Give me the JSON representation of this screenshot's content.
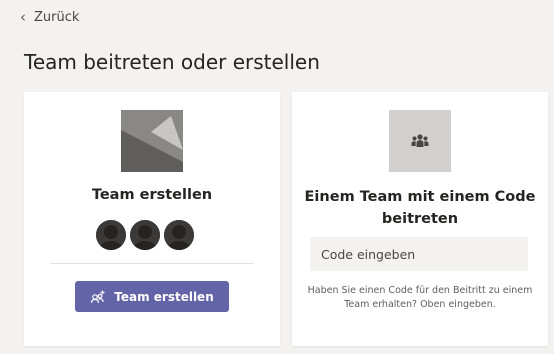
{
  "nav": {
    "back_label": "Zurück"
  },
  "page": {
    "title": "Team beitreten oder erstellen"
  },
  "create_card": {
    "title": "Team erstellen",
    "button_label": "Team erstellen",
    "button_icon": "add-team-icon",
    "image_icon": "team-image-placeholder",
    "avatar_count": 3
  },
  "join_card": {
    "title": "Einem Team mit einem Code beitreten",
    "image_icon": "people-group-icon",
    "code_placeholder": "Code eingeben",
    "help_text": "Haben Sie einen Code für den Beitritt zu einem Team erhalten? Oben eingeben."
  },
  "colors": {
    "accent": "#6264a7",
    "page_background": "#f3f2f1",
    "card_background": "#ffffff"
  }
}
